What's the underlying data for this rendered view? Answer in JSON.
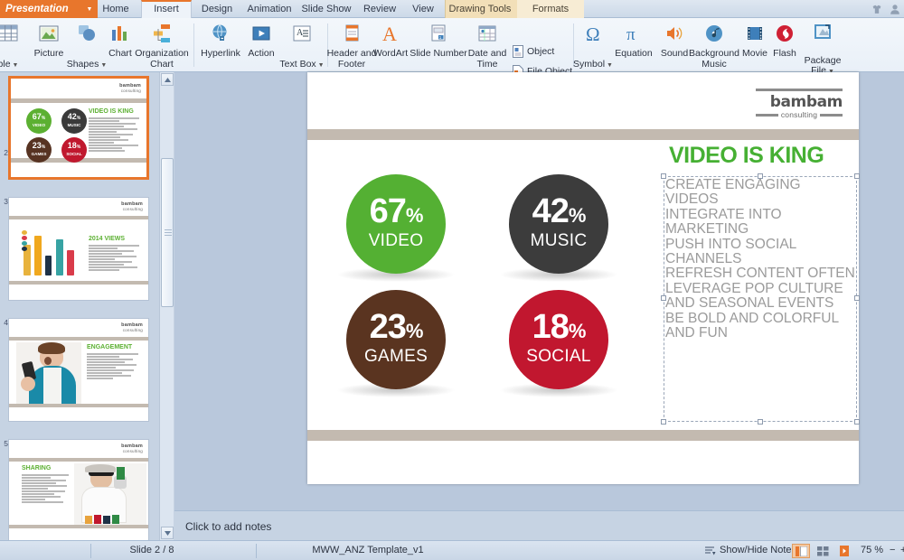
{
  "window": {
    "file_menu": "Presentation",
    "tabs": [
      "Home",
      "Insert",
      "Design",
      "Animation",
      "Slide Show",
      "Review",
      "View"
    ],
    "active_tab": "Insert",
    "context_group": "Drawing Tools",
    "context_tabs": [
      "Formats"
    ],
    "top_right_icons": [
      "skin-icon",
      "user-account-icon"
    ]
  },
  "ribbon": {
    "buttons": [
      {
        "label": "ble",
        "icon": "table-icon",
        "caret": true
      },
      {
        "label": "Picture",
        "icon": "picture-icon",
        "caret": false
      },
      {
        "label": "Shapes",
        "icon": "shapes-icon",
        "caret": true
      },
      {
        "label": "Chart",
        "icon": "chart-icon",
        "caret": false
      },
      {
        "label": "Organization\nChart",
        "icon": "org-chart-icon",
        "caret": false
      },
      {
        "label": "Hyperlink",
        "icon": "hyperlink-icon",
        "caret": false
      },
      {
        "label": "Action",
        "icon": "action-icon",
        "caret": false
      },
      {
        "label": "Text Box",
        "icon": "text-box-icon",
        "caret": true
      },
      {
        "label": "Header and\nFooter",
        "icon": "header-footer-icon",
        "caret": false
      },
      {
        "label": "WordArt",
        "icon": "wordart-icon",
        "caret": false
      },
      {
        "label": "Slide Number",
        "icon": "slide-number-icon",
        "caret": false
      },
      {
        "label": "Date and\nTime",
        "icon": "date-time-icon",
        "caret": false
      },
      {
        "label": "Symbol",
        "icon": "symbol-icon",
        "caret": true
      },
      {
        "label": "Equation",
        "icon": "equation-icon",
        "caret": false
      },
      {
        "label": "Sound",
        "icon": "sound-icon",
        "caret": false
      },
      {
        "label": "Background\nMusic",
        "icon": "background-music-icon",
        "caret": false
      },
      {
        "label": "Movie",
        "icon": "movie-icon",
        "caret": false
      },
      {
        "label": "Flash",
        "icon": "flash-icon",
        "caret": false
      },
      {
        "label": "Package\nFile",
        "icon": "package-file-icon",
        "caret": true
      }
    ],
    "stacked": [
      {
        "label": "Object",
        "icon": "object-icon"
      },
      {
        "label": "File Object",
        "icon": "file-object-icon"
      }
    ]
  },
  "thumbnails": [
    {
      "number": "2",
      "selected": true,
      "title": "VIDEO IS KING",
      "circles": [
        {
          "pct": "67",
          "name": "VIDEO",
          "color": "#5cb032"
        },
        {
          "pct": "42",
          "name": "MUSIC",
          "color": "#3a3a3a"
        },
        {
          "pct": "23",
          "name": "GAMES",
          "color": "#573322"
        },
        {
          "pct": "18",
          "name": "SOCIAL",
          "color": "#c0182e"
        }
      ]
    },
    {
      "number": "3",
      "selected": false,
      "title": "2014 VIEWS",
      "kind": "bar-chart"
    },
    {
      "number": "4",
      "selected": false,
      "title": "ENGAGEMENT",
      "kind": "photo-woman-phone"
    },
    {
      "number": "5",
      "selected": false,
      "title": "SHARING",
      "kind": "photo-scientist"
    }
  ],
  "slide": {
    "logo_name": "bambam",
    "logo_sub": "consulting",
    "title": "VIDEO IS KING",
    "body_text": "CREATE ENGAGING VIDEOS\nINTEGRATE INTO MARKETING\nPUSH INTO SOCIAL CHANNELS\nREFRESH CONTENT OFTEN\nLEVERAGE POP CULTURE\nAND SEASONAL EVENTS\nBE BOLD AND COLORFUL\nAND FUN",
    "title_color": "#46b033",
    "body_color": "#9b9b9b",
    "band_color": "#c3bab0",
    "circles": [
      {
        "pct": "67",
        "unit": "%",
        "name": "VIDEO",
        "color": "#54b033"
      },
      {
        "pct": "42",
        "unit": "%",
        "name": "MUSIC",
        "color": "#3c3c3c"
      },
      {
        "pct": "23",
        "unit": "%",
        "name": "GAMES",
        "color": "#5a3420"
      },
      {
        "pct": "18",
        "unit": "%",
        "name": "SOCIAL",
        "color": "#c1172f"
      }
    ]
  },
  "notes": {
    "placeholder": "Click to add notes"
  },
  "status": {
    "slide_counter": "Slide 2 / 8",
    "template_name": "MWW_ANZ Template_v1",
    "show_hide_note": "Show/Hide Note",
    "zoom": "75 %",
    "zoom_out": "−",
    "zoom_in": "+",
    "view_buttons": [
      "normal-view-icon",
      "slide-sorter-icon",
      "slideshow-icon"
    ]
  }
}
